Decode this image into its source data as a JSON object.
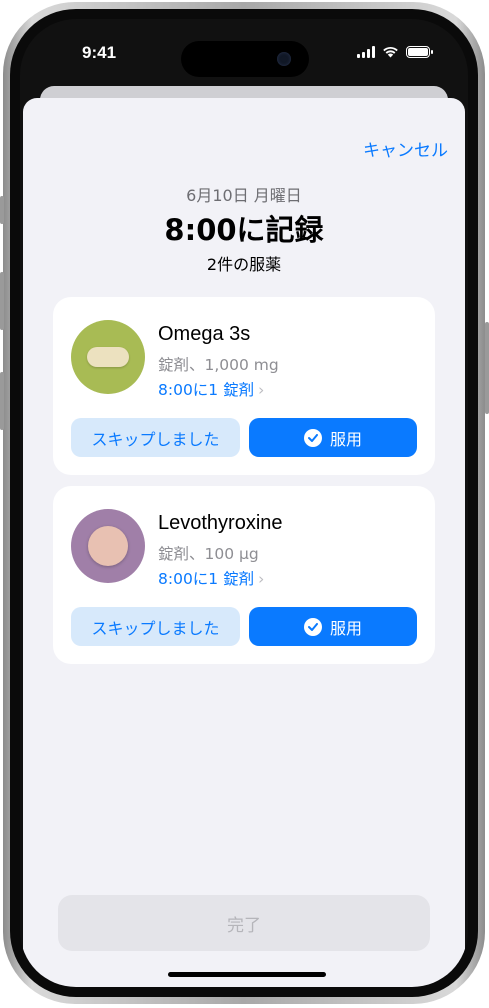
{
  "status_bar": {
    "time": "9:41"
  },
  "header": {
    "cancel_label": "キャンセル",
    "date": "6月10日 月曜日",
    "title": "8:00に記録",
    "subtitle": "2件の服薬"
  },
  "medications": [
    {
      "name": "Omega 3s",
      "form": "錠剤、1,000 mg",
      "schedule": "8:00に1 錠剤",
      "skip_label": "スキップしました",
      "take_label": "服用",
      "icon": "pill-icon",
      "pill_bg_color": "#a8bb54",
      "pill_color": "#ece1bf"
    },
    {
      "name": "Levothyroxine",
      "form": "錠剤、100 µg",
      "schedule": "8:00に1 錠剤",
      "skip_label": "スキップしました",
      "take_label": "服用",
      "icon": "tablet-icon",
      "pill_bg_color": "#a07fa8",
      "pill_color": "#e8c1b2"
    }
  ],
  "footer": {
    "done_label": "完了"
  },
  "colors": {
    "accent": "#0a7aff",
    "skip_button_bg": "#d7e9fb",
    "sheet_bg": "#f2f2f7"
  }
}
